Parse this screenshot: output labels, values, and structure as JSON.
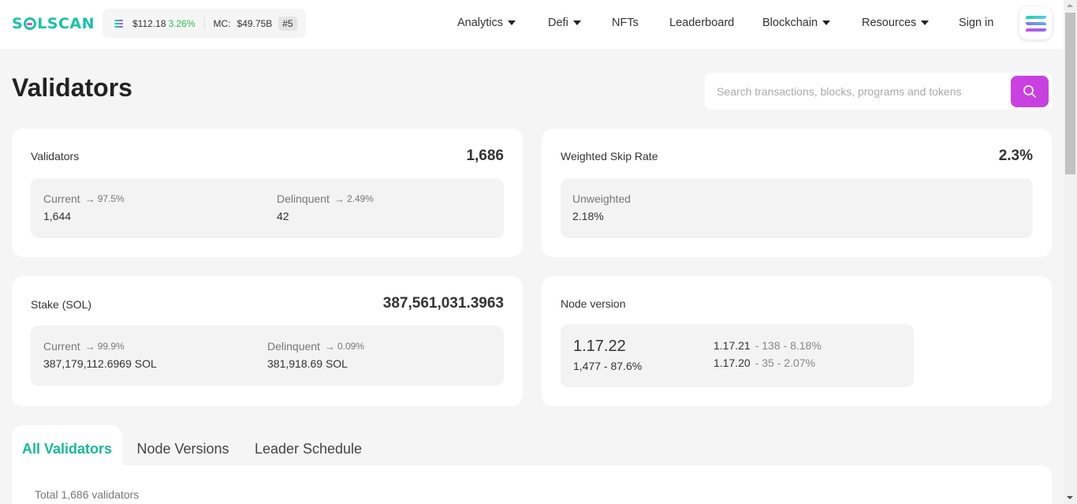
{
  "header": {
    "logo": {
      "pre": "S",
      "post": "LSCAN"
    },
    "price": "$112.18",
    "change": "3.26%",
    "mc_label": "MC:",
    "mc_value": "$49.75B",
    "rank": "#5",
    "nav": [
      {
        "label": "Analytics",
        "dropdown": true
      },
      {
        "label": "Defi",
        "dropdown": true
      },
      {
        "label": "NFTs",
        "dropdown": false
      },
      {
        "label": "Leaderboard",
        "dropdown": false
      },
      {
        "label": "Blockchain",
        "dropdown": true
      },
      {
        "label": "Resources",
        "dropdown": true
      },
      {
        "label": "Sign in",
        "dropdown": false
      }
    ]
  },
  "page": {
    "title": "Validators"
  },
  "search": {
    "placeholder": "Search transactions, blocks, programs and tokens"
  },
  "validators_card": {
    "label": "Validators",
    "value": "1,686",
    "current_label": "Current",
    "current_pct": "97.5%",
    "current_value": "1,644",
    "delinquent_label": "Delinquent",
    "delinquent_pct": "2.49%",
    "delinquent_value": "42"
  },
  "skip_card": {
    "label": "Weighted Skip Rate",
    "value": "2.3%",
    "unweighted_label": "Unweighted",
    "unweighted_value": "2.18%"
  },
  "stake_card": {
    "label": "Stake (SOL)",
    "value": "387,561,031.3963",
    "current_label": "Current",
    "current_pct": "99.9%",
    "current_value": "387,179,112.6969 SOL",
    "delinquent_label": "Delinquent",
    "delinquent_pct": "0.09%",
    "delinquent_value": "381,918.69 SOL"
  },
  "node_card": {
    "label": "Node version",
    "main_version": "1.17.22",
    "main_meta": "1,477 - 87.6%",
    "others": [
      {
        "version": "1.17.21",
        "meta": "- 138 - 8.18%"
      },
      {
        "version": "1.17.20",
        "meta": "- 35 - 2.07%"
      }
    ]
  },
  "tabs": [
    {
      "label": "All Validators",
      "active": true
    },
    {
      "label": "Node Versions",
      "active": false
    },
    {
      "label": "Leader Schedule",
      "active": false
    }
  ],
  "list": {
    "total": "Total 1,686 validators"
  },
  "colors": {
    "brand": "#19c3a6",
    "accent": "#c940e0",
    "positive": "#2fbf4f"
  }
}
